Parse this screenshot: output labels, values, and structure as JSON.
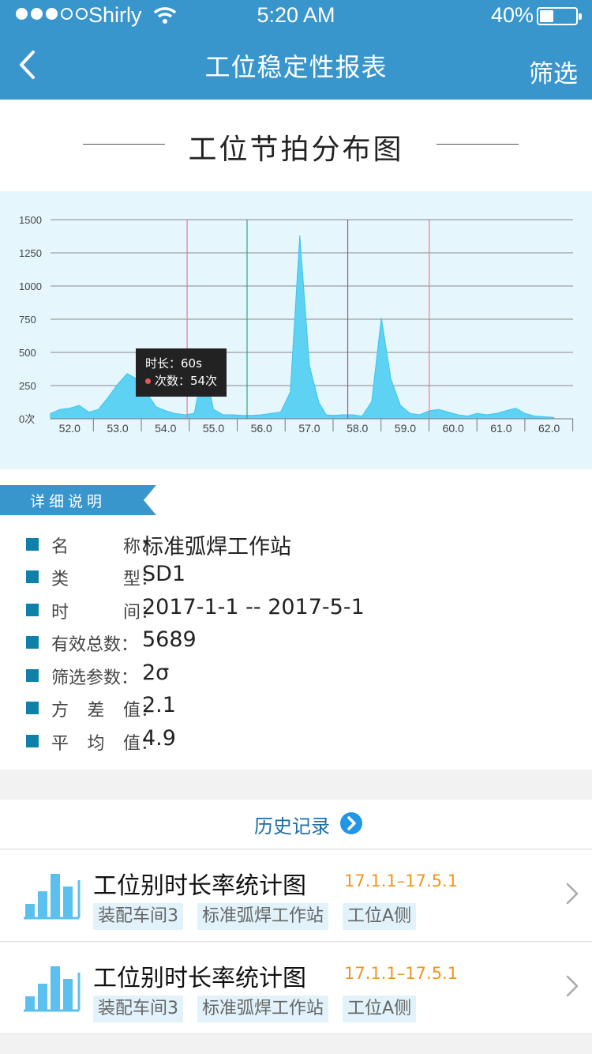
{
  "status": {
    "carrier": "Shirly",
    "time": "5:20 AM",
    "battery": "40%",
    "battery_level": 0.4,
    "signal_bars": 3
  },
  "nav": {
    "title": "工位稳定性报表",
    "right": "筛选"
  },
  "section_title": "工位节拍分布图",
  "chart_data": {
    "type": "area",
    "title": "",
    "x": [
      51.6,
      51.8,
      52.0,
      52.2,
      52.4,
      52.6,
      52.8,
      53.0,
      53.2,
      53.4,
      53.6,
      53.8,
      54.0,
      54.2,
      54.4,
      54.6,
      54.8,
      55.0,
      55.2,
      55.4,
      55.6,
      55.8,
      56.0,
      56.2,
      56.4,
      56.6,
      56.8,
      57.0,
      57.2,
      57.35,
      57.5,
      57.7,
      57.9,
      58.1,
      58.3,
      58.5,
      58.7,
      58.9,
      59.1,
      59.3,
      59.5,
      59.7,
      59.9,
      60.1,
      60.3,
      60.5,
      60.7,
      60.9,
      61.1,
      61.3,
      61.5,
      61.7,
      61.9,
      62.1
    ],
    "values": [
      40,
      70,
      80,
      100,
      50,
      70,
      160,
      260,
      340,
      300,
      200,
      90,
      60,
      40,
      30,
      40,
      420,
      70,
      30,
      30,
      25,
      25,
      30,
      40,
      50,
      200,
      1380,
      400,
      120,
      30,
      25,
      30,
      30,
      20,
      130,
      760,
      300,
      100,
      40,
      30,
      60,
      70,
      50,
      30,
      20,
      40,
      30,
      40,
      60,
      80,
      40,
      20,
      15,
      10
    ],
    "x_ticks": [
      "52.0",
      "53.0",
      "54.0",
      "55.0",
      "56.0",
      "57.0",
      "58.0",
      "59.0",
      "60.0",
      "61.0",
      "62.0"
    ],
    "y_ticks": [
      "0次",
      "250",
      "500",
      "750",
      "1000",
      "1250",
      "1500"
    ],
    "ylim": [
      0,
      1500
    ],
    "xlim": [
      51.6,
      62.5
    ],
    "grid": true,
    "color": "#5ed2f2",
    "ref_lines": [
      {
        "x": 54.45,
        "color": "#f07a8f"
      },
      {
        "x": 55.7,
        "color": "#2aa67a"
      },
      {
        "x": 57.8,
        "color": "#b34e8e"
      },
      {
        "x": 59.5,
        "color": "#f07a8f"
      }
    ],
    "tooltip": {
      "line1": "时长：60s",
      "line2": "次数：54次"
    }
  },
  "details": {
    "ribbon": "详细说明",
    "rows": [
      {
        "label": [
          "名",
          "称："
        ],
        "value": "标准弧焊工作站"
      },
      {
        "label": [
          "类",
          "型："
        ],
        "value": "SD1"
      },
      {
        "label": [
          "时",
          "间："
        ],
        "value": "2017-1-1 -- 2017-5-1"
      },
      {
        "label": [
          "有效总数："
        ],
        "value": "5689"
      },
      {
        "label": [
          "筛选参数："
        ],
        "value": "2σ"
      },
      {
        "label": [
          "方",
          "差",
          "值："
        ],
        "value": "2.1"
      },
      {
        "label": [
          "平",
          "均",
          "值："
        ],
        "value": "4.9"
      }
    ]
  },
  "history": {
    "label": "历史记录"
  },
  "items": [
    {
      "title": "工位别时长率统计图",
      "date": "17.1.1–17.5.1",
      "tags": [
        "装配车间3",
        "标准弧焊工作站",
        "工位A侧"
      ]
    },
    {
      "title": "工位别时长率统计图",
      "date": "17.1.1–17.5.1",
      "tags": [
        "装配车间3",
        "标准弧焊工作站",
        "工位A侧"
      ]
    }
  ],
  "colors": {
    "primary": "#3896cc",
    "accent": "#f0961e",
    "chart_bg": "#e6f6fd",
    "square": "#0f81a8"
  }
}
